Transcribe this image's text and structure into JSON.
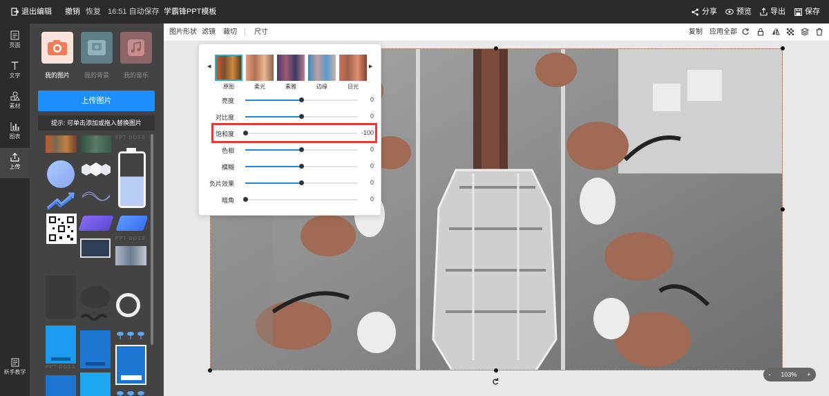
{
  "topbar": {
    "exit_label": "退出编辑",
    "undo_label": "撤销",
    "redo_label": "恢复",
    "autosave_text": "16:51 自动保存",
    "doc_title": "学霸锋PPT模板",
    "share_label": "分享",
    "preview_label": "预览",
    "export_label": "导出",
    "save_label": "保存"
  },
  "leftnav": {
    "items": [
      {
        "label": "页面",
        "icon": "page-icon"
      },
      {
        "label": "文字",
        "icon": "text-icon"
      },
      {
        "label": "素材",
        "icon": "shapes-icon"
      },
      {
        "label": "图表",
        "icon": "chart-icon"
      },
      {
        "label": "上传",
        "icon": "upload-icon",
        "active": true
      }
    ],
    "tutorial_label": "新手教学"
  },
  "panel": {
    "tabs": [
      {
        "label": "我的图片",
        "icon": "camera-icon",
        "active": true
      },
      {
        "label": "我的背景",
        "icon": "background-icon"
      },
      {
        "label": "我的音乐",
        "icon": "music-icon"
      }
    ],
    "upload_button": "上传图片",
    "hint": "提示: 可单击添加或拖入替换图片",
    "watermark": "PPT-DOSS"
  },
  "toolbar": {
    "left": [
      "图片形状",
      "滤镜",
      "裁切",
      "尺寸"
    ],
    "right": [
      "复制",
      "应用全部"
    ]
  },
  "filter_popup": {
    "presets": [
      "原图",
      "柔光",
      "素雅",
      "边缘",
      "日光"
    ],
    "sliders": [
      {
        "label": "亮度",
        "value": 0,
        "fraction": 0.5
      },
      {
        "label": "对比度",
        "value": 0,
        "fraction": 0.5
      },
      {
        "label": "饱和度",
        "value": -100,
        "fraction": 0.0
      },
      {
        "label": "色相",
        "value": 0,
        "fraction": 0.5
      },
      {
        "label": "模糊",
        "value": 0,
        "fraction": 0.5
      },
      {
        "label": "负片效果",
        "value": 0,
        "fraction": 0.5
      },
      {
        "label": "暗角",
        "value": 0,
        "fraction": 0.0
      }
    ]
  },
  "zoom": {
    "minus": "-",
    "value": "103%",
    "plus": "+"
  },
  "colors": {
    "accent": "#1e8fff",
    "highlight": "#e53935",
    "dark": "#2b2b2b"
  }
}
